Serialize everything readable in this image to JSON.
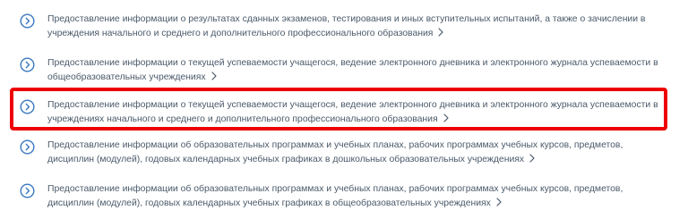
{
  "services": [
    {
      "text": "Предоставление информации о результатах сданных экзаменов, тестирования и иных вступительных испытаний, а также о зачислении в учреждения начального и среднего и дополнительного профессионального образования",
      "icon": "chevron-circle-icon",
      "arrow_icon": "chevron-right-icon"
    },
    {
      "text": "Предоставление информации о текущей успеваемости учащегося, ведение электронного дневника и электронного журнала успеваемости в общеобразовательных учреждениях",
      "icon": "chevron-circle-icon",
      "arrow_icon": "chevron-right-icon"
    },
    {
      "text": "Предоставление информации о текущей успеваемости учащегося, ведение электронного дневника и электронного журнала успеваемости в учреждениях начального и среднего и дополнительного профессионального образования",
      "icon": "chevron-circle-icon",
      "arrow_icon": "chevron-right-icon",
      "highlighted": true
    },
    {
      "text": "Предоставление информации об образовательных программах и учебных планах, рабочих программах учебных курсов, предметов, дисциплин (модулей), годовых календарных учебных графиках в дошкольных образовательных учреждениях",
      "icon": "chevron-circle-icon",
      "arrow_icon": "chevron-right-icon"
    },
    {
      "text": "Предоставление информации об образовательных программах и учебных планах, рабочих программах учебных курсов, предметов, дисциплин (модулей), годовых календарных учебных графиках в общеобразовательных учреждениях",
      "icon": "chevron-circle-icon",
      "arrow_icon": "chevron-right-icon"
    }
  ],
  "colors": {
    "text": "#4b5a6a",
    "icon": "#3a78c0",
    "highlight": "#ee0000"
  }
}
